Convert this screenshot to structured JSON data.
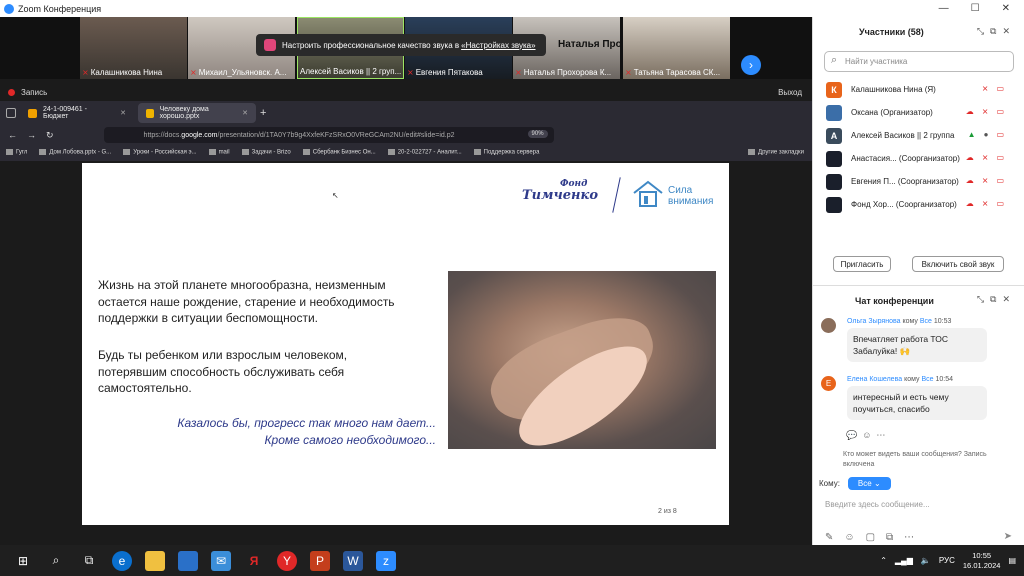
{
  "window": {
    "title": "Zoom Конференция"
  },
  "gallery": {
    "participants": [
      "Калашникова Нина",
      "Михаил_Ульяновск. А...",
      "Алексей Васиков || 2 груп...",
      "Евгения Пятакова",
      "Наталья Прохорова К...",
      "Татьяна Тарасова СК..."
    ],
    "notification": "Настроить профессиональное качество звука в",
    "notification_link": "«Настройках звука»",
    "overlay_name": "Наталья Прохо..."
  },
  "record": {
    "label": "Запись",
    "exit": "Выход"
  },
  "browser": {
    "tabs": [
      "24-1-009461 - Бюджет",
      "Человеку дома хорошо.pptx"
    ],
    "url_prefix": "https://docs.",
    "url_domain": "google.com",
    "url_rest": "/presentation/d/1TA0Y7b9g4XxfeKFzSRxO0VReGCAm2NU/edit#slide=id.p2",
    "zoom": "90%",
    "bookmarks": [
      "Гугл",
      "Дом Лобова.pptx - G...",
      "Уроки - Российская э...",
      "mail",
      "Задачи - Brizo",
      "Сбербанк Бизнес Он...",
      "20-2-022727 - Аналит...",
      "Поддержка сервера"
    ],
    "other_bookmarks": "Другие закладки"
  },
  "slide": {
    "logo_top": "Фонд",
    "logo_main": "Тимченко",
    "logo2_line1": "Сила",
    "logo2_line2": "внимания",
    "para1": [
      "Жизнь на этой планете многообразна, неизменным",
      "остается наше рождение, старение и необходимость",
      "поддержки в ситуации беспомощности."
    ],
    "para2": [
      "Будь ты ребенком или взрослым человеком,",
      "потерявшим способность обслуживать себя",
      "самостоятельно."
    ],
    "quote": [
      "Казалось бы, прогресс так много нам дает...",
      "Кроме самого необходимого..."
    ],
    "page": "2 из 8"
  },
  "panel": {
    "title": "Участники (58)",
    "search_placeholder": "Найти участника",
    "people": [
      {
        "initial": "К",
        "name": "Калашникова Нина (Я)",
        "color": "#e8641b"
      },
      {
        "initial": "",
        "name": "Оксана (Организатор)",
        "color": "#3b6ea8"
      },
      {
        "initial": "А",
        "name": "Алексей Васиков || 2 группа",
        "color": "#3a4b5c"
      },
      {
        "initial": "",
        "name": "Анастасия... (Соорганизатор)",
        "color": "#1a1f2b"
      },
      {
        "initial": "",
        "name": "Евгения П... (Соорганизатор)",
        "color": "#1a1f2b"
      },
      {
        "initial": "",
        "name": "Фонд Хор... (Соорганизатор)",
        "color": "#1a1f2b"
      }
    ],
    "invite": "Пригласить",
    "unmute": "Включить свой звук"
  },
  "chat": {
    "title": "Чат конференции",
    "messages": [
      {
        "sender": "Ольга Зырянова",
        "to_word": "кому",
        "to": "Все",
        "time": "10:53",
        "text": "Впечатляет работа ТОС Забалуйка! 🙌",
        "initial": "",
        "color": "#8a6d5a"
      },
      {
        "sender": "Елена Кошелева",
        "to_word": "кому",
        "to": "Все",
        "time": "10:54",
        "text": "интересный и есть чему поучиться, спасибо",
        "initial": "Е",
        "color": "#e8641b"
      }
    ],
    "visibility": "Кто может видеть ваши сообщения? Запись включена",
    "to_label": "Кому:",
    "to_value": "Все",
    "input_placeholder": "Введите здесь сообщение..."
  },
  "taskbar": {
    "lang": "РУС",
    "time": "10:55",
    "date": "16.01.2024"
  }
}
